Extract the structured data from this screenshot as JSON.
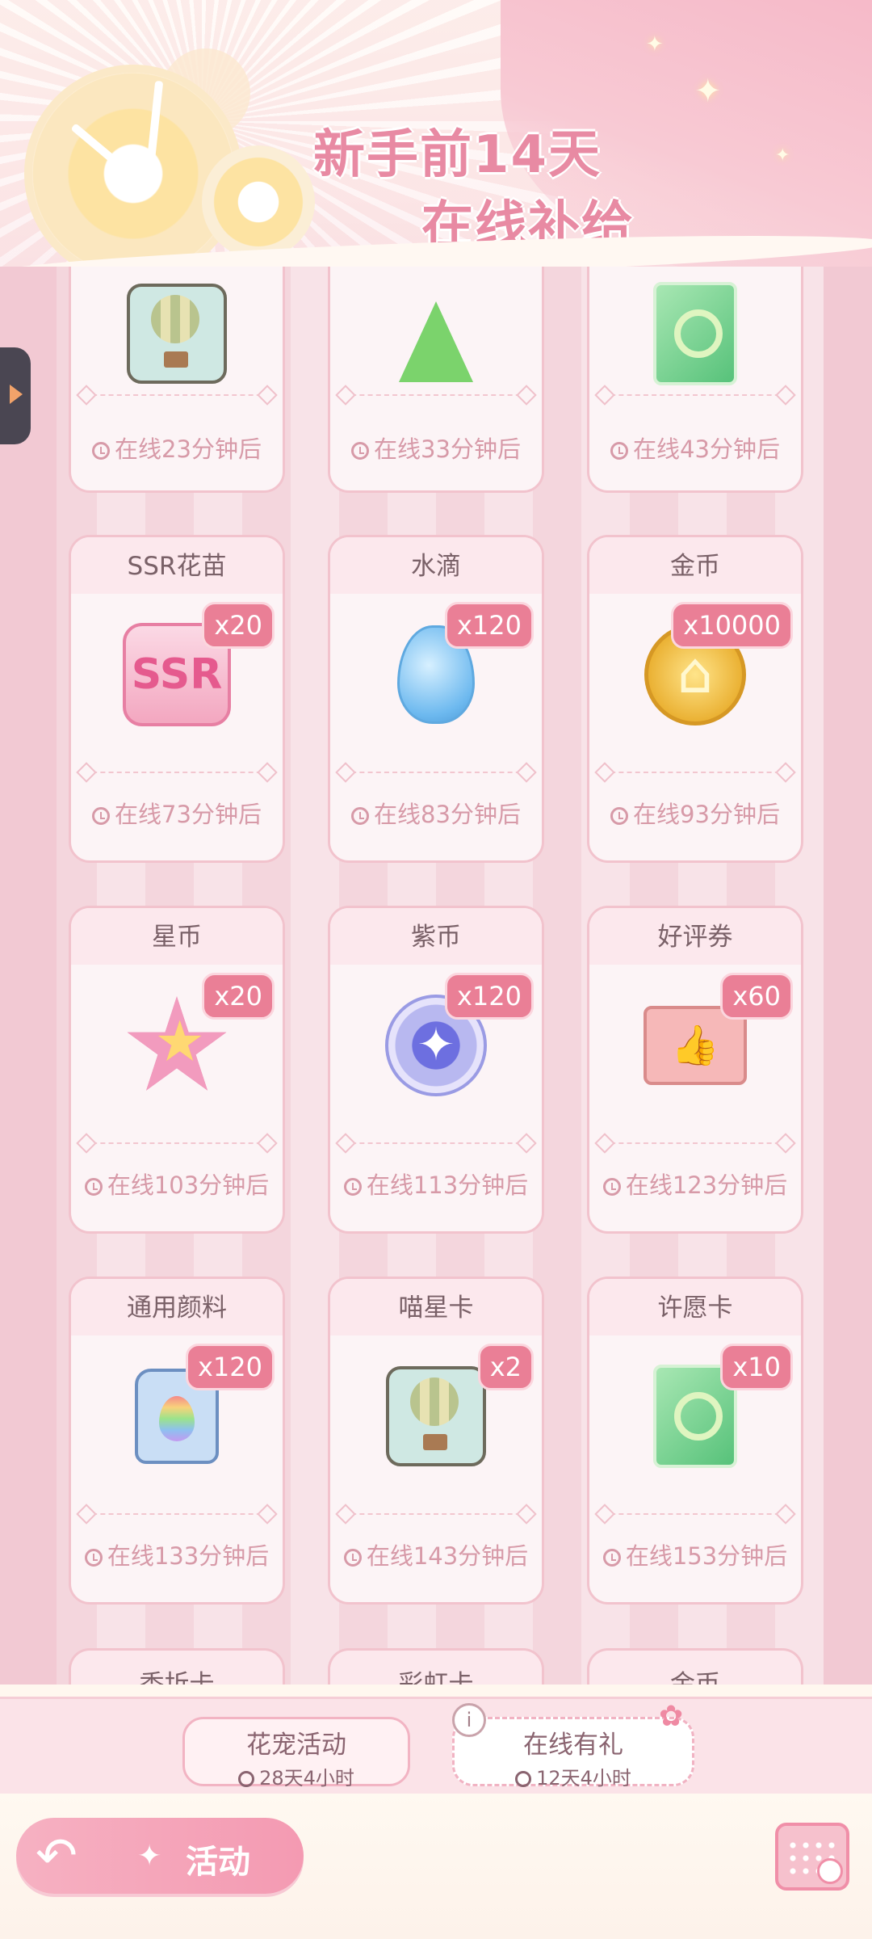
{
  "header": {
    "title_line1": "新手前14天",
    "title_line2": "在线补给"
  },
  "rows": [
    [
      {
        "name": "",
        "badge": "",
        "time": "在线23分钟后",
        "icon": "balloon-icon"
      },
      {
        "name": "",
        "badge": "",
        "time": "在线33分钟后",
        "icon": "flask-icon"
      },
      {
        "name": "",
        "badge": "",
        "time": "在线43分钟后",
        "icon": "wish-card-icon"
      }
    ],
    [
      {
        "name": "SSR花苗",
        "badge": "x20",
        "time": "在线73分钟后",
        "icon": "ssr-icon"
      },
      {
        "name": "水滴",
        "badge": "x120",
        "time": "在线83分钟后",
        "icon": "water-drop-icon"
      },
      {
        "name": "金币",
        "badge": "x10000",
        "time": "在线93分钟后",
        "icon": "gold-coin-icon"
      }
    ],
    [
      {
        "name": "星币",
        "badge": "x20",
        "time": "在线103分钟后",
        "icon": "star-coin-icon"
      },
      {
        "name": "紫币",
        "badge": "x120",
        "time": "在线113分钟后",
        "icon": "purple-coin-icon"
      },
      {
        "name": "好评券",
        "badge": "x60",
        "time": "在线123分钟后",
        "icon": "review-ticket-icon"
      }
    ],
    [
      {
        "name": "通用颜料",
        "badge": "x120",
        "time": "在线133分钟后",
        "icon": "paint-icon"
      },
      {
        "name": "喵星卡",
        "badge": "x2",
        "time": "在线143分钟后",
        "icon": "balloon-icon"
      },
      {
        "name": "许愿卡",
        "badge": "x10",
        "time": "在线153分钟后",
        "icon": "wish-card-icon"
      }
    ]
  ],
  "partial_row": [
    "香圻卡",
    "彩虹卡",
    "金币"
  ],
  "tabs": [
    {
      "title": "花宠活动",
      "time": "28天4小时"
    },
    {
      "title": "在线有礼",
      "time": "12天4小时"
    }
  ],
  "bottom": {
    "activity_label": "活动"
  }
}
